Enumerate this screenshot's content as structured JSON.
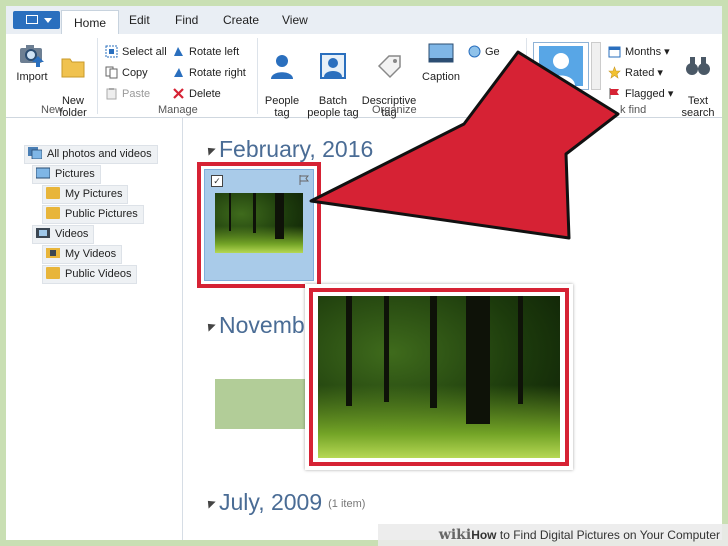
{
  "menubar": {
    "tabs": [
      {
        "label": "Home",
        "active": true
      },
      {
        "label": "Edit"
      },
      {
        "label": "Find"
      },
      {
        "label": "Create"
      },
      {
        "label": "View"
      }
    ]
  },
  "ribbon": {
    "new_group": {
      "label": "New",
      "import": "Import",
      "new_folder": "New\nfolder"
    },
    "manage_group": {
      "label": "Manage",
      "select_all": "Select all",
      "copy": "Copy",
      "paste": "Paste",
      "rotate_left": "Rotate left",
      "rotate_right": "Rotate right",
      "delete": "Delete"
    },
    "organize_group": {
      "label": "Organize",
      "people_tag": "People\ntag",
      "batch_people_tag": "Batch\npeople tag",
      "descriptive_tag": "Descriptive\ntag",
      "caption": "Caption",
      "geo_partial": "Ge"
    },
    "find_group": {
      "label": "k find",
      "months": "Months",
      "rated": "Rated",
      "flagged": "Flagged",
      "text_search": "Text\nsearch"
    }
  },
  "sidebar": {
    "items": [
      {
        "label": "All photos and videos",
        "icon": "photos-videos-icon"
      },
      {
        "label": "Pictures",
        "icon": "pictures-icon"
      },
      {
        "label": "My Pictures",
        "icon": "folder-icon"
      },
      {
        "label": "Public Pictures",
        "icon": "folder-icon"
      },
      {
        "label": "Videos",
        "icon": "videos-icon"
      },
      {
        "label": "My Videos",
        "icon": "video-folder-icon"
      },
      {
        "label": "Public Videos",
        "icon": "folder-icon"
      }
    ]
  },
  "main": {
    "groups": [
      {
        "title": "February, 2016",
        "count": ""
      },
      {
        "title": "Novemb",
        "count": ""
      },
      {
        "title": "July, 2009",
        "count": "(1 item)"
      }
    ]
  },
  "watermark": {
    "site": "wiki",
    "text_bold": "How",
    "text": "to Find Digital Pictures on Your Computer"
  },
  "colors": {
    "highlight_red": "#d62234",
    "accent_blue": "#2a6fbe",
    "thumb_selected": "#a9cbe9",
    "background_green": "#c9dfb3"
  }
}
